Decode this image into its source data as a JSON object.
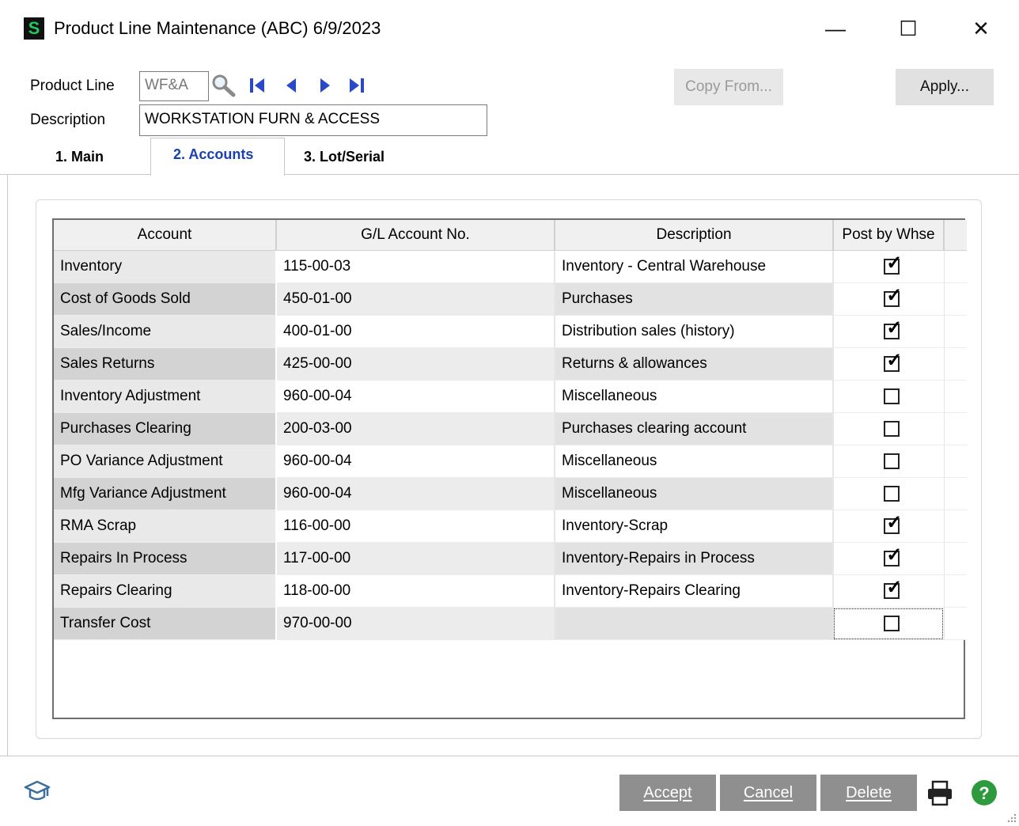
{
  "window": {
    "app_icon": "S",
    "title": "Product Line Maintenance (ABC) 6/9/2023",
    "minimize_glyph": "—",
    "maximize_glyph": "☐",
    "close_glyph": "✕"
  },
  "header": {
    "product_line_label": "Product Line",
    "product_line_value": "WF&A",
    "description_label": "Description",
    "description_value": "WORKSTATION FURN & ACCESS",
    "copy_from_label": "Copy From...",
    "apply_label": "Apply..."
  },
  "tabs": [
    {
      "label": "1. Main",
      "active": false
    },
    {
      "label": "2. Accounts",
      "active": true
    },
    {
      "label": "3. Lot/Serial",
      "active": false
    }
  ],
  "grid": {
    "columns": [
      "Account",
      "G/L Account No.",
      "Description",
      "Post by Whse"
    ],
    "rows": [
      {
        "account": "Inventory",
        "gl": "115-00-03",
        "desc": "Inventory - Central Warehouse",
        "post": true
      },
      {
        "account": "Cost of Goods Sold",
        "gl": "450-01-00",
        "desc": "Purchases",
        "post": true
      },
      {
        "account": "Sales/Income",
        "gl": "400-01-00",
        "desc": "Distribution sales (history)",
        "post": true
      },
      {
        "account": "Sales Returns",
        "gl": "425-00-00",
        "desc": "Returns & allowances",
        "post": true
      },
      {
        "account": "Inventory Adjustment",
        "gl": "960-00-04",
        "desc": "Miscellaneous",
        "post": false
      },
      {
        "account": "Purchases Clearing",
        "gl": "200-03-00",
        "desc": "Purchases clearing account",
        "post": false
      },
      {
        "account": "PO Variance Adjustment",
        "gl": "960-00-04",
        "desc": "Miscellaneous",
        "post": false
      },
      {
        "account": "Mfg Variance Adjustment",
        "gl": "960-00-04",
        "desc": "Miscellaneous",
        "post": false
      },
      {
        "account": "RMA Scrap",
        "gl": "116-00-00",
        "desc": "Inventory-Scrap",
        "post": true
      },
      {
        "account": "Repairs In Process",
        "gl": "117-00-00",
        "desc": "Inventory-Repairs in Process",
        "post": true
      },
      {
        "account": "Repairs Clearing",
        "gl": "118-00-00",
        "desc": "Inventory-Repairs Clearing",
        "post": true
      },
      {
        "account": "Transfer Cost",
        "gl": "970-00-00",
        "desc": "",
        "post": false
      }
    ]
  },
  "footer": {
    "accept_label": "Accept",
    "cancel_label": "Cancel",
    "delete_label": "Delete"
  },
  "icons": {
    "app": "sage-s-icon",
    "lookup": "magnifier-icon",
    "first": "first-record-icon",
    "prev": "previous-record-icon",
    "next": "next-record-icon",
    "last": "last-record-icon",
    "help_course": "graduation-cap-icon",
    "print": "printer-icon",
    "help": "help-icon"
  },
  "colors": {
    "accent_tab_text": "#1a3fb5",
    "nav_blue": "#2a49c8",
    "help_green": "#2e9a3e",
    "footer_button": "#8f8f8f"
  }
}
